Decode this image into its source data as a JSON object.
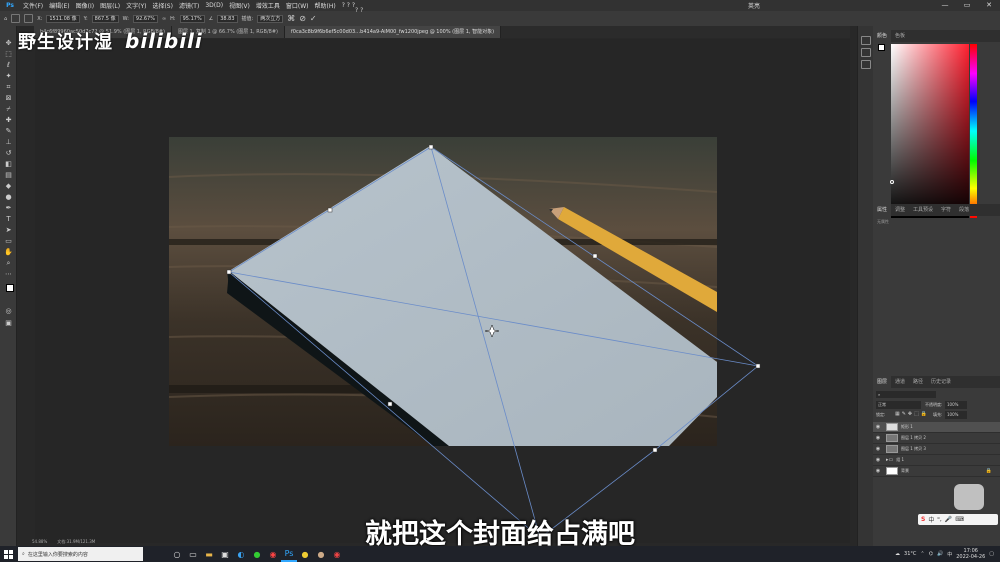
{
  "app": {
    "menu": [
      "文件(F)",
      "编辑(E)",
      "图像(I)",
      "图层(L)",
      "文字(Y)",
      "选择(S)",
      "滤镜(T)",
      "3D(D)",
      "视图(V)",
      "增效工具",
      "窗口(W)",
      "帮助(H)",
      "? ? ?"
    ],
    "window_title": "英亮",
    "options": {
      "x_val": "1511.08 像",
      "y_val": "867.5 像",
      "w_val": "92.67%",
      "h_val": "95.17%",
      "angle_val": "38.83",
      "interp_label": "插值:",
      "mode_label": "两次立方",
      "q_marks": "? ?"
    },
    "tabs": [
      "b4c6f89960ac50d7c72 @ 51.9% (图层 1, RGB/8#)",
      "图层 1, 复制 1 @ 66.7% (图层 1, RGB/8#)",
      "f0ca3c8b9f6b6ef5c00d03…b414a9-AiM00_fw1200jpeg @ 100% (图层 1, 智能对象)"
    ]
  },
  "watermark": {
    "channel": "野生设计湿",
    "brand": "bilibili"
  },
  "subtitle": "就把这个封面给占满吧",
  "status": {
    "zoom": "54.88%",
    "doc": "文档:31.9M/121.3M"
  },
  "panels": {
    "color_tabs": [
      "颜色",
      "色板"
    ],
    "mid_tabs": [
      "属性",
      "调整",
      "工具预设",
      "字符",
      "段落"
    ],
    "mid_sub": "无属性",
    "layer_tabs": [
      "图层",
      "通道",
      "路径",
      "历史记录"
    ],
    "blend_mode": "正常",
    "opacity_label": "不透明度:",
    "opacity": "100%",
    "lock_label": "锁定:",
    "fill_label": "填充:",
    "fill": "100%",
    "layers": [
      {
        "name": "矩形 1",
        "selected": true
      },
      {
        "name": "图层 1 拷贝 2",
        "selected": false
      },
      {
        "name": "图层 1 拷贝 3",
        "selected": false
      },
      {
        "name": "组 1",
        "selected": false
      },
      {
        "name": "背景",
        "selected": false
      }
    ]
  },
  "taskbar": {
    "search_placeholder": "在这里输入你要搜索的内容",
    "weather": "31°C",
    "time": "17:06",
    "date": "2022-04-26",
    "ime_label": "中"
  }
}
